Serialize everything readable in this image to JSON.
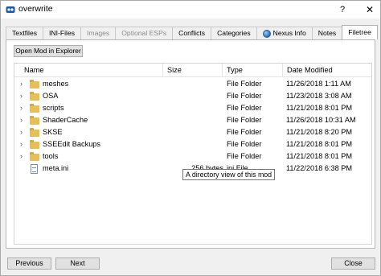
{
  "window": {
    "title": "overwrite",
    "help_label": "?",
    "close_label": "✕"
  },
  "tabs": [
    {
      "label": "Textfiles",
      "state": "normal"
    },
    {
      "label": "INI-Files",
      "state": "normal"
    },
    {
      "label": "Images",
      "state": "disabled"
    },
    {
      "label": "Optional ESPs",
      "state": "disabled"
    },
    {
      "label": "Conflicts",
      "state": "normal"
    },
    {
      "label": "Categories",
      "state": "normal"
    },
    {
      "label": "Nexus Info",
      "state": "normal",
      "icon": "globe-icon"
    },
    {
      "label": "Notes",
      "state": "normal"
    },
    {
      "label": "Filetree",
      "state": "active"
    }
  ],
  "filetree": {
    "open_button_label": "Open Mod in Explorer",
    "columns": {
      "name": "Name",
      "size": "Size",
      "type": "Type",
      "date": "Date Modified"
    },
    "rows": [
      {
        "name": "meshes",
        "size": "",
        "type": "File Folder",
        "date": "11/26/2018 1:11 AM",
        "kind": "folder"
      },
      {
        "name": "OSA",
        "size": "",
        "type": "File Folder",
        "date": "11/23/2018 3:08 AM",
        "kind": "folder"
      },
      {
        "name": "scripts",
        "size": "",
        "type": "File Folder",
        "date": "11/21/2018 8:01 PM",
        "kind": "folder"
      },
      {
        "name": "ShaderCache",
        "size": "",
        "type": "File Folder",
        "date": "11/26/2018 10:31 AM",
        "kind": "folder"
      },
      {
        "name": "SKSE",
        "size": "",
        "type": "File Folder",
        "date": "11/21/2018 8:20 PM",
        "kind": "folder"
      },
      {
        "name": "SSEEdit Backups",
        "size": "",
        "type": "File Folder",
        "date": "11/21/2018 8:01 PM",
        "kind": "folder"
      },
      {
        "name": "tools",
        "size": "",
        "type": "File Folder",
        "date": "11/21/2018 8:01 PM",
        "kind": "folder"
      },
      {
        "name": "meta.ini",
        "size": "256 bytes",
        "type": "ini File",
        "date": "11/22/2018 6:38 PM",
        "kind": "file"
      }
    ],
    "tooltip": "A directory view of this mod"
  },
  "footer": {
    "previous_label": "Previous",
    "next_label": "Next",
    "close_label": "Close"
  },
  "colors": {
    "folder": "#e8be56",
    "window_bg": "#f0f0f0",
    "button_bg": "#e1e1e1"
  }
}
